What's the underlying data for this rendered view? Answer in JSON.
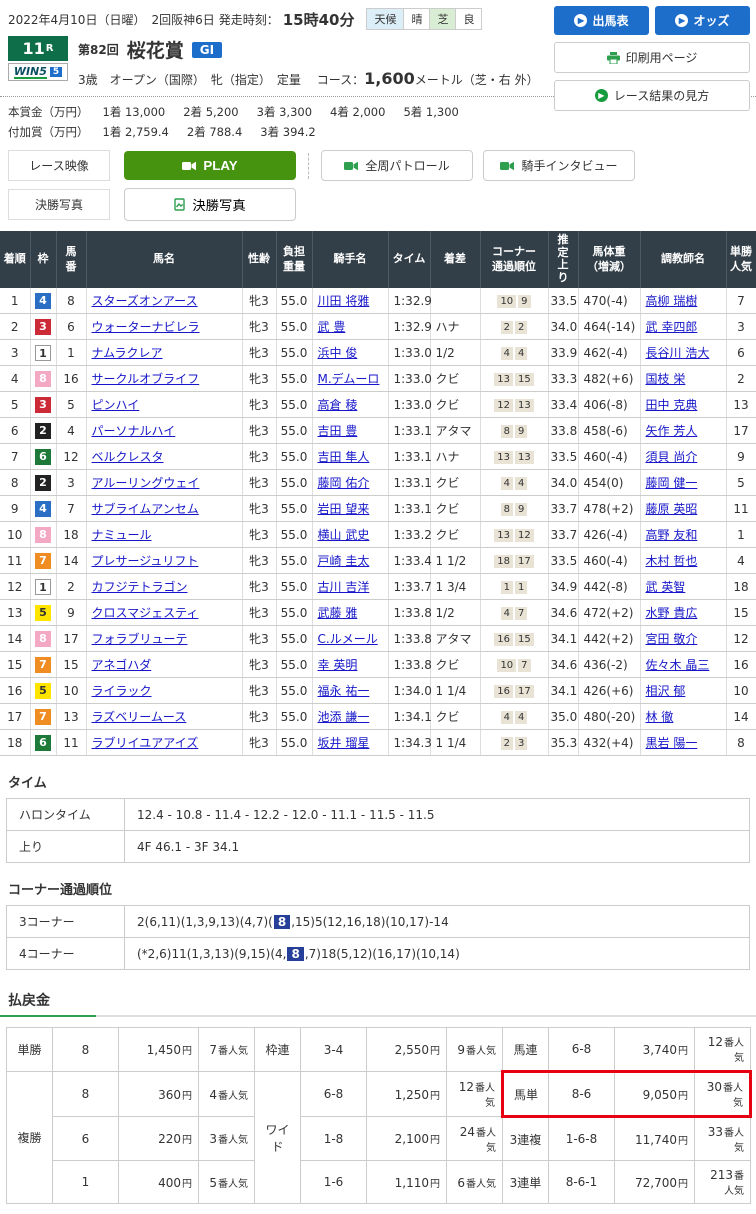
{
  "header": {
    "date_line": "2022年4月10日（日曜）　2回阪神6日",
    "start_label": "発走時刻：",
    "start_time": "15時40分",
    "weather": {
      "label1": "天候",
      "value1": "晴",
      "label2": "芝",
      "value2": "良"
    }
  },
  "actions": {
    "entry_table": "出馬表",
    "odds": "オッズ",
    "print_page": "印刷用ページ",
    "how_to_read": "レース結果の見方"
  },
  "race": {
    "number": "11",
    "number_suffix": "R",
    "win5_text": "WIN5",
    "win5_num": "5",
    "edition": "第82回",
    "name": "桜花賞",
    "grade": "GI",
    "conditions": "3歳　オープン（国際）　牝（指定）　定量",
    "course_label": "コース：",
    "course_value": "1,600",
    "course_unit": "メートル（芝・右 外）"
  },
  "prize": {
    "rows": [
      {
        "label": "本賞金（万円）",
        "items": [
          "1着 13,000",
          "2着 5,200",
          "3着 3,300",
          "4着 2,000",
          "5着 1,300"
        ]
      },
      {
        "label": "付加賞（万円）",
        "items": [
          "1着 2,759.4",
          "2着 788.4",
          "3着 394.2"
        ]
      }
    ]
  },
  "media": {
    "race_video_label": "レース映像",
    "play": "PLAY",
    "patrol": "全周パトロール",
    "interview": "騎手インタビュー",
    "photo_label": "決勝写真",
    "photo_button": "決勝写真"
  },
  "icons": {
    "entry_arrow": "circle-arrow",
    "odds_arrow": "circle-arrow",
    "print": "printer",
    "guide_arrow": "circle-arrow",
    "play": "video-camera",
    "patrol": "video-camera",
    "interview": "video-camera",
    "photo": "photo-document"
  },
  "colors": {
    "table_header_bg": "#333f48",
    "link": "#1717c9",
    "blue_button": "#1d6dcb",
    "green_play": "#45930f",
    "race_number_badge": "#0e6e49",
    "grade_badge": "#1d6dcb",
    "red_highlight": "#e60012",
    "corner_highlight": "#26409a",
    "chip_bg": "#e8e3d5",
    "payout_label_bg": "#eeebdd"
  },
  "frame_colors": {
    "1": {
      "bg": "#ffffff",
      "fg": "#333333",
      "border": true
    },
    "2": {
      "bg": "#222222",
      "fg": "#ffffff"
    },
    "3": {
      "bg": "#cc2a36",
      "fg": "#ffffff"
    },
    "4": {
      "bg": "#2a6fc4",
      "fg": "#ffffff"
    },
    "5": {
      "bg": "#ffe400",
      "fg": "#333333"
    },
    "6": {
      "bg": "#1d7a38",
      "fg": "#ffffff"
    },
    "7": {
      "bg": "#ef8c22",
      "fg": "#ffffff"
    },
    "8": {
      "bg": "#f3a9c3",
      "fg": "#ffffff"
    }
  },
  "results": {
    "columns": [
      {
        "l1": "着順"
      },
      {
        "l1": "枠"
      },
      {
        "l1": "馬",
        "l2": "番"
      },
      {
        "l1": "馬名"
      },
      {
        "l1": "性齢"
      },
      {
        "l1": "負担",
        "l2": "重量"
      },
      {
        "l1": "騎手名"
      },
      {
        "l1": "タイム"
      },
      {
        "l1": "着差"
      },
      {
        "l1": "コーナー",
        "l2": "通過順位"
      },
      {
        "l1": "推定上り",
        "vertical": true
      },
      {
        "l1": "馬体重",
        "l2": "（増減）"
      },
      {
        "l1": "調教師名"
      },
      {
        "l1": "単勝",
        "l2": "人気"
      }
    ],
    "rows": [
      {
        "pos": "1",
        "frame": "4",
        "num": "8",
        "horse": "スターズオンアース",
        "sex_age": "牝3",
        "weight": "55.0",
        "jockey": "川田 将雅",
        "time": "1:32.9",
        "margin": "",
        "corners": [
          "10",
          "9"
        ],
        "last3f": "33.5",
        "body": "470(-4)",
        "trainer": "高柳 瑞樹",
        "fav": "7"
      },
      {
        "pos": "2",
        "frame": "3",
        "num": "6",
        "horse": "ウォーターナビレラ",
        "sex_age": "牝3",
        "weight": "55.0",
        "jockey": "武 豊",
        "time": "1:32.9",
        "margin": "ハナ",
        "corners": [
          "2",
          "2"
        ],
        "last3f": "34.0",
        "body": "464(-14)",
        "trainer": "武 幸四郎",
        "fav": "3"
      },
      {
        "pos": "3",
        "frame": "1",
        "num": "1",
        "horse": "ナムラクレア",
        "sex_age": "牝3",
        "weight": "55.0",
        "jockey": "浜中 俊",
        "time": "1:33.0",
        "margin": "1/2",
        "corners": [
          "4",
          "4"
        ],
        "last3f": "33.9",
        "body": "462(-4)",
        "trainer": "長谷川 浩大",
        "fav": "6"
      },
      {
        "pos": "4",
        "frame": "8",
        "num": "16",
        "horse": "サークルオブライフ",
        "sex_age": "牝3",
        "weight": "55.0",
        "jockey": "M.デムーロ",
        "time": "1:33.0",
        "margin": "クビ",
        "corners": [
          "13",
          "15"
        ],
        "last3f": "33.3",
        "body": "482(+6)",
        "trainer": "国枝 栄",
        "fav": "2"
      },
      {
        "pos": "5",
        "frame": "3",
        "num": "5",
        "horse": "ピンハイ",
        "sex_age": "牝3",
        "weight": "55.0",
        "jockey": "高倉 稜",
        "time": "1:33.0",
        "margin": "クビ",
        "corners": [
          "12",
          "13"
        ],
        "last3f": "33.4",
        "body": "406(-8)",
        "trainer": "田中 克典",
        "fav": "13"
      },
      {
        "pos": "6",
        "frame": "2",
        "num": "4",
        "horse": "パーソナルハイ",
        "sex_age": "牝3",
        "weight": "55.0",
        "jockey": "吉田 豊",
        "time": "1:33.1",
        "margin": "アタマ",
        "corners": [
          "8",
          "9"
        ],
        "last3f": "33.8",
        "body": "458(-6)",
        "trainer": "矢作 芳人",
        "fav": "17"
      },
      {
        "pos": "7",
        "frame": "6",
        "num": "12",
        "horse": "ベルクレスタ",
        "sex_age": "牝3",
        "weight": "55.0",
        "jockey": "吉田 隼人",
        "time": "1:33.1",
        "margin": "ハナ",
        "corners": [
          "13",
          "13"
        ],
        "last3f": "33.5",
        "body": "460(-4)",
        "trainer": "須貝 尚介",
        "fav": "9"
      },
      {
        "pos": "8",
        "frame": "2",
        "num": "3",
        "horse": "アルーリングウェイ",
        "sex_age": "牝3",
        "weight": "55.0",
        "jockey": "藤岡 佑介",
        "time": "1:33.1",
        "margin": "クビ",
        "corners": [
          "4",
          "4"
        ],
        "last3f": "34.0",
        "body": "454(0)",
        "trainer": "藤岡 健一",
        "fav": "5"
      },
      {
        "pos": "9",
        "frame": "4",
        "num": "7",
        "horse": "サブライムアンセム",
        "sex_age": "牝3",
        "weight": "55.0",
        "jockey": "岩田 望来",
        "time": "1:33.1",
        "margin": "クビ",
        "corners": [
          "8",
          "9"
        ],
        "last3f": "33.7",
        "body": "478(+2)",
        "trainer": "藤原 英昭",
        "fav": "11"
      },
      {
        "pos": "10",
        "frame": "8",
        "num": "18",
        "horse": "ナミュール",
        "sex_age": "牝3",
        "weight": "55.0",
        "jockey": "横山 武史",
        "time": "1:33.2",
        "margin": "クビ",
        "corners": [
          "13",
          "12"
        ],
        "last3f": "33.7",
        "body": "426(-4)",
        "trainer": "高野 友和",
        "fav": "1"
      },
      {
        "pos": "11",
        "frame": "7",
        "num": "14",
        "horse": "プレサージュリフト",
        "sex_age": "牝3",
        "weight": "55.0",
        "jockey": "戸崎 圭太",
        "time": "1:33.4",
        "margin": "1 1/2",
        "corners": [
          "18",
          "17"
        ],
        "last3f": "33.5",
        "body": "460(-4)",
        "trainer": "木村 哲也",
        "fav": "4"
      },
      {
        "pos": "12",
        "frame": "1",
        "num": "2",
        "horse": "カフジテトラゴン",
        "sex_age": "牝3",
        "weight": "55.0",
        "jockey": "古川 吉洋",
        "time": "1:33.7",
        "margin": "1 3/4",
        "corners": [
          "1",
          "1"
        ],
        "last3f": "34.9",
        "body": "442(-8)",
        "trainer": "武 英智",
        "fav": "18"
      },
      {
        "pos": "13",
        "frame": "5",
        "num": "9",
        "horse": "クロスマジェスティ",
        "sex_age": "牝3",
        "weight": "55.0",
        "jockey": "武藤 雅",
        "time": "1:33.8",
        "margin": "1/2",
        "corners": [
          "4",
          "7"
        ],
        "last3f": "34.6",
        "body": "472(+2)",
        "trainer": "水野 貴広",
        "fav": "15"
      },
      {
        "pos": "14",
        "frame": "8",
        "num": "17",
        "horse": "フォラブリューテ",
        "sex_age": "牝3",
        "weight": "55.0",
        "jockey": "C.ルメール",
        "time": "1:33.8",
        "margin": "アタマ",
        "corners": [
          "16",
          "15"
        ],
        "last3f": "34.1",
        "body": "442(+2)",
        "trainer": "宮田 敬介",
        "fav": "12"
      },
      {
        "pos": "15",
        "frame": "7",
        "num": "15",
        "horse": "アネゴハダ",
        "sex_age": "牝3",
        "weight": "55.0",
        "jockey": "幸 英明",
        "time": "1:33.8",
        "margin": "クビ",
        "corners": [
          "10",
          "7"
        ],
        "last3f": "34.6",
        "body": "436(-2)",
        "trainer": "佐々木 晶三",
        "fav": "16"
      },
      {
        "pos": "16",
        "frame": "5",
        "num": "10",
        "horse": "ライラック",
        "sex_age": "牝3",
        "weight": "55.0",
        "jockey": "福永 祐一",
        "time": "1:34.0",
        "margin": "1 1/4",
        "corners": [
          "16",
          "17"
        ],
        "last3f": "34.1",
        "body": "426(+6)",
        "trainer": "相沢 郁",
        "fav": "10"
      },
      {
        "pos": "17",
        "frame": "7",
        "num": "13",
        "horse": "ラズベリームース",
        "sex_age": "牝3",
        "weight": "55.0",
        "jockey": "池添 謙一",
        "time": "1:34.1",
        "margin": "クビ",
        "corners": [
          "4",
          "4"
        ],
        "last3f": "35.0",
        "body": "480(-20)",
        "trainer": "林 徹",
        "fav": "14"
      },
      {
        "pos": "18",
        "frame": "6",
        "num": "11",
        "horse": "ラブリイユアアイズ",
        "sex_age": "牝3",
        "weight": "55.0",
        "jockey": "坂井 瑠星",
        "time": "1:34.3",
        "margin": "1 1/4",
        "corners": [
          "2",
          "3"
        ],
        "last3f": "35.3",
        "body": "432(+4)",
        "trainer": "黒岩 陽一",
        "fav": "8"
      }
    ]
  },
  "time_section": {
    "title": "タイム",
    "rows": [
      {
        "label": "ハロンタイム",
        "value": "12.4 - 10.8 - 11.4 - 12.2 - 12.0 - 11.1 - 11.5 - 11.5"
      },
      {
        "label": "上り",
        "value": "4F 46.1 - 3F 34.1"
      }
    ]
  },
  "corner_section": {
    "title": "コーナー通過順位",
    "rows": [
      {
        "label": "3コーナー",
        "pre": "2(6,11)(1,3,9,13)(4,7)(",
        "highlight": "8",
        "post": ",15)5(12,16,18)(10,17)-14"
      },
      {
        "label": "4コーナー",
        "pre": "(*2,6)11(1,3,13)(9,15)(4,",
        "highlight": "8",
        "post": ",7)18(5,12)(16,17)(10,14)"
      }
    ]
  },
  "payout": {
    "title": "払戻金",
    "unit_suffix": "円",
    "fav_suffix": "番人気",
    "groups": [
      {
        "rows": [
          {
            "label": "単勝",
            "combo": "8",
            "amount": "1,450",
            "fav": "7"
          },
          {
            "label": "複勝",
            "combo": "8",
            "amount": "360",
            "fav": "4"
          },
          {
            "combo": "6",
            "amount": "220",
            "fav": "3"
          },
          {
            "combo": "1",
            "amount": "400",
            "fav": "5"
          }
        ]
      },
      {
        "rows": [
          {
            "label": "枠連",
            "combo": "3-4",
            "amount": "2,550",
            "fav": "9"
          },
          {
            "label": "ワイド",
            "combo": "6-8",
            "amount": "1,250",
            "fav": "12"
          },
          {
            "combo": "1-8",
            "amount": "2,100",
            "fav": "24"
          },
          {
            "combo": "1-6",
            "amount": "1,110",
            "fav": "6"
          }
        ]
      },
      {
        "rows": [
          {
            "label": "馬連",
            "combo": "6-8",
            "amount": "3,740",
            "fav": "12"
          },
          {
            "label": "馬単",
            "combo": "8-6",
            "amount": "9,050",
            "fav": "30",
            "highlight": true
          },
          {
            "label": "3連複",
            "combo": "1-6-8",
            "amount": "11,740",
            "fav": "33"
          },
          {
            "label": "3連単",
            "combo": "8-6-1",
            "amount": "72,700",
            "fav": "213"
          }
        ]
      }
    ]
  }
}
